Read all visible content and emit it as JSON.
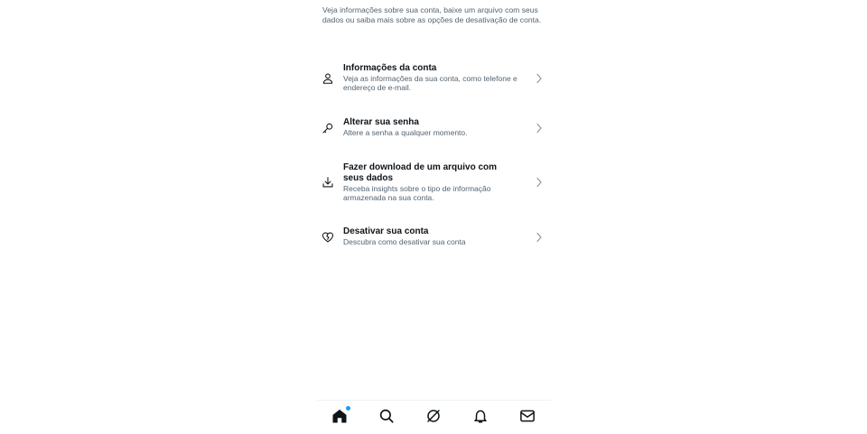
{
  "intro": "Veja informações sobre sua conta, baixe um arquivo com seus dados ou saiba mais sobre as opções de desativação de conta.",
  "items": [
    {
      "icon": "person-icon",
      "title": "Informações da conta",
      "description": "Veja as informações da sua conta, como telefone e endereço de e-mail."
    },
    {
      "icon": "key-icon",
      "title": "Alterar sua senha",
      "description": "Altere a senha a qualquer momento."
    },
    {
      "icon": "download-icon",
      "title": "Fazer download de um arquivo com seus dados",
      "description": "Receba insights sobre o tipo de informação armazenada na sua conta."
    },
    {
      "icon": "broken-heart-icon",
      "title": "Desativar sua conta",
      "description": "Descubra como desativar sua conta"
    }
  ],
  "nav": {
    "home": "home-icon",
    "search": "search-icon",
    "grok": "grok-icon",
    "notifications": "bell-icon",
    "messages": "mail-icon"
  },
  "colors": {
    "text_primary": "#0f1419",
    "text_secondary": "#536471",
    "accent": "#1d9bf0",
    "divider": "#eff3f4"
  }
}
